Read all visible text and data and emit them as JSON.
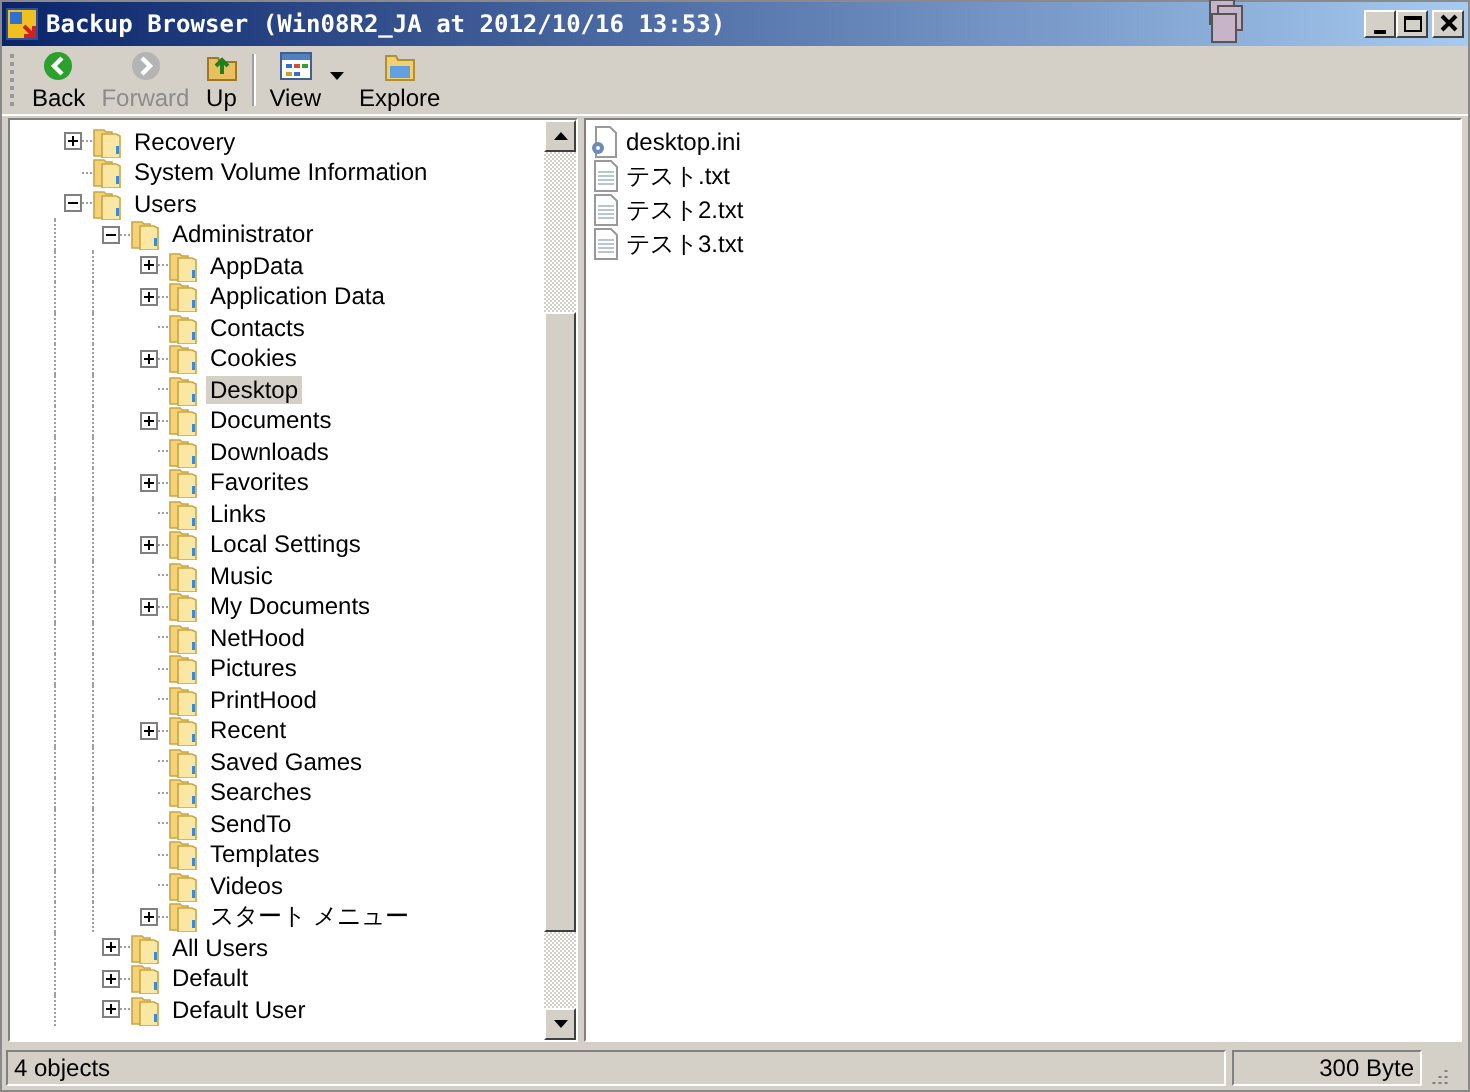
{
  "window": {
    "title": "Backup Browser (Win08R2_JA at 2012/10/16 13:53)"
  },
  "toolbar": [
    {
      "label": "Back",
      "kind": "back",
      "disabled": false
    },
    {
      "label": "Forward",
      "kind": "forward",
      "disabled": true
    },
    {
      "label": "Up",
      "kind": "up",
      "disabled": false
    },
    {
      "label": "View",
      "kind": "view",
      "disabled": false
    },
    {
      "label": "Explore",
      "kind": "explore",
      "disabled": false
    }
  ],
  "tree": [
    {
      "label": "Recovery",
      "expanded": false,
      "selected": false
    },
    {
      "label": "System Volume Information",
      "selected": false
    },
    {
      "label": "Users",
      "expanded": true,
      "selected": false,
      "children": [
        {
          "label": "Administrator",
          "expanded": true,
          "selected": false,
          "children": [
            {
              "label": "AppData",
              "expanded": false,
              "selected": false
            },
            {
              "label": "Application Data",
              "expanded": false,
              "selected": false
            },
            {
              "label": "Contacts",
              "selected": false
            },
            {
              "label": "Cookies",
              "expanded": false,
              "selected": false
            },
            {
              "label": "Desktop",
              "selected": true
            },
            {
              "label": "Documents",
              "expanded": false,
              "selected": false
            },
            {
              "label": "Downloads",
              "selected": false
            },
            {
              "label": "Favorites",
              "expanded": false,
              "selected": false
            },
            {
              "label": "Links",
              "selected": false
            },
            {
              "label": "Local Settings",
              "expanded": false,
              "selected": false
            },
            {
              "label": "Music",
              "selected": false
            },
            {
              "label": "My Documents",
              "expanded": false,
              "selected": false
            },
            {
              "label": "NetHood",
              "selected": false
            },
            {
              "label": "Pictures",
              "selected": false
            },
            {
              "label": "PrintHood",
              "selected": false
            },
            {
              "label": "Recent",
              "expanded": false,
              "selected": false
            },
            {
              "label": "Saved Games",
              "selected": false
            },
            {
              "label": "Searches",
              "selected": false
            },
            {
              "label": "SendTo",
              "selected": false
            },
            {
              "label": "Templates",
              "selected": false
            },
            {
              "label": "Videos",
              "selected": false
            },
            {
              "label": "スタート メニュー",
              "expanded": false,
              "selected": false
            }
          ]
        },
        {
          "label": "All Users",
          "expanded": false,
          "selected": false
        },
        {
          "label": "Default",
          "expanded": false,
          "selected": false
        },
        {
          "label": "Default User",
          "expanded": false,
          "selected": false
        }
      ]
    }
  ],
  "files": [
    {
      "name": "desktop.ini",
      "kind": "settings"
    },
    {
      "name": "テスト.txt",
      "kind": "text"
    },
    {
      "name": "テスト2.txt",
      "kind": "text"
    },
    {
      "name": "テスト3.txt",
      "kind": "text"
    }
  ],
  "status_bar": {
    "objects": "4 objects",
    "size": "300 Byte"
  }
}
